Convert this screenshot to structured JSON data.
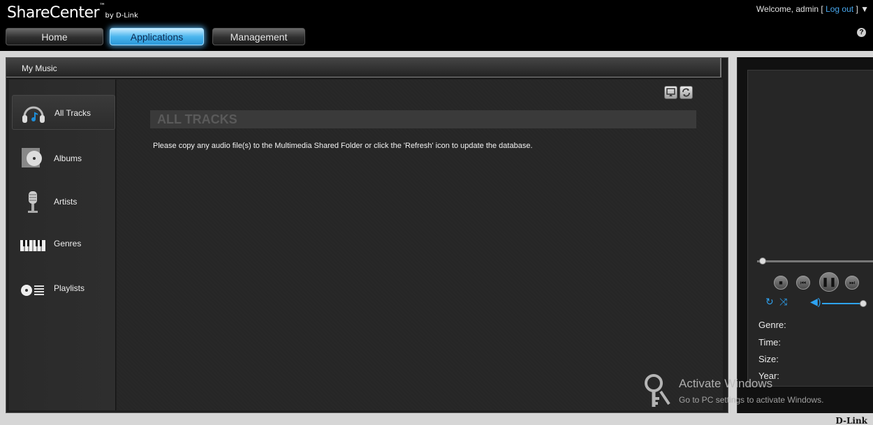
{
  "header": {
    "logo": "ShareCenter",
    "logo_tm": "™",
    "logo_by": "by D-Link",
    "welcome_prefix": "Welcome, admin [",
    "logout": "Log out",
    "welcome_suffix": "] ▼",
    "help": "?",
    "tabs": [
      {
        "label": "Home",
        "active": false
      },
      {
        "label": "Applications",
        "active": true
      },
      {
        "label": "Management",
        "active": false
      }
    ]
  },
  "panel": {
    "title": "My Music"
  },
  "sidebar": {
    "items": [
      {
        "label": "All Tracks",
        "icon": "headphones-icon",
        "active": true
      },
      {
        "label": "Albums",
        "icon": "album-icon",
        "active": false
      },
      {
        "label": "Artists",
        "icon": "microphone-icon",
        "active": false
      },
      {
        "label": "Genres",
        "icon": "piano-keys-icon",
        "active": false
      },
      {
        "label": "Playlists",
        "icon": "playlist-icon",
        "active": false
      }
    ]
  },
  "content": {
    "section_title": "ALL TRACKS",
    "message": "Please copy any audio file(s) to the Multimedia Shared Folder or click the 'Refresh' icon to update the database."
  },
  "player": {
    "meta": [
      "Genre:",
      "Time:",
      "Size:",
      "Year:"
    ],
    "progress": 0.03,
    "volume": 1.0
  },
  "watermark": {
    "title": "Activate Windows",
    "subtitle": "Go to PC settings to activate Windows."
  },
  "footer": {
    "brand": "D-Link"
  },
  "colors": {
    "accent": "#2ea3f2",
    "link": "#49a8ee"
  }
}
